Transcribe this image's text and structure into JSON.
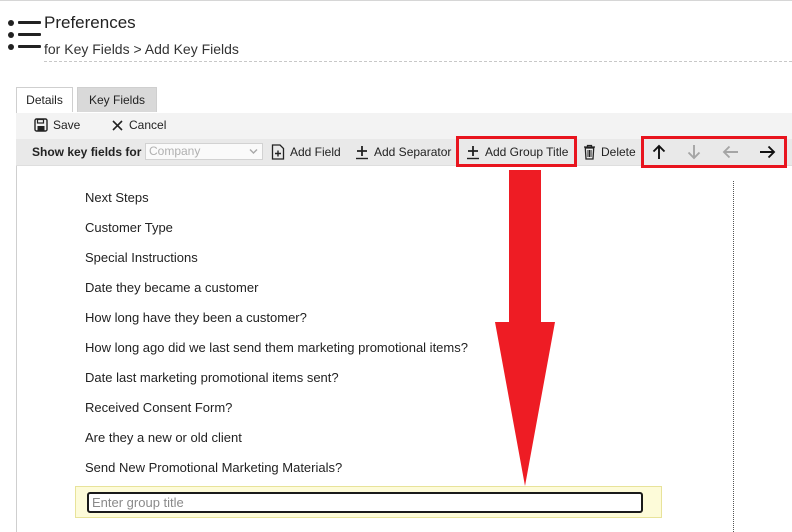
{
  "header": {
    "title": "Preferences",
    "subtitle": "for Key Fields > Add Key Fields"
  },
  "tabs": [
    {
      "label": "Details",
      "active": false
    },
    {
      "label": "Key Fields",
      "active": true
    }
  ],
  "toolbar": {
    "save_label": "Save",
    "cancel_label": "Cancel",
    "show_label": "Show key fields for",
    "entity_select_value": "Company",
    "add_field_label": "Add Field",
    "add_separator_label": "Add Separator",
    "add_group_title_label": "Add Group Title",
    "delete_label": "Delete"
  },
  "fields": [
    "Next Steps",
    "Customer Type",
    "Special Instructions",
    "Date they became a customer",
    "How long have they been a customer?",
    "How long ago did we last send them marketing promotional items?",
    "Date last marketing promotional items sent?",
    "Received Consent Form?",
    "Are they a new or old client",
    "Send New Promotional Marketing Materials?"
  ],
  "group_title_input": {
    "value": "",
    "placeholder": "Enter group title"
  },
  "colors": {
    "highlight": "#e8141e",
    "tab_active_bg": "#d9d9d9",
    "group_row_bg": "#fdfbd9"
  },
  "icons": {
    "menu": "menu-list-icon",
    "save": "floppy-disk-icon",
    "cancel": "x-close-icon",
    "add_field": "add-field-icon",
    "add_separator": "plus-icon",
    "add_group_title": "plus-underline-icon",
    "delete": "trash-icon",
    "move_up": "arrow-up-icon",
    "move_down": "arrow-down-icon",
    "move_left": "arrow-left-icon",
    "move_right": "arrow-right-icon"
  }
}
